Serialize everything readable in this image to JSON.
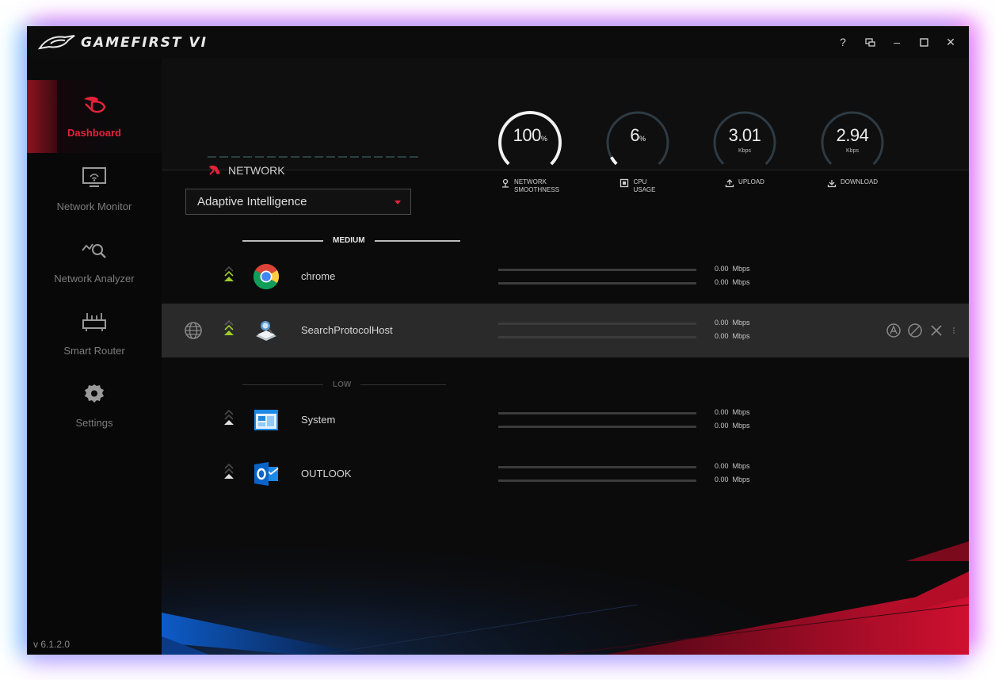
{
  "app": {
    "title": "GAMEFIRST VI",
    "version": "v 6.1.2.0"
  },
  "window_controls": [
    {
      "name": "help-button",
      "glyph": "?"
    },
    {
      "name": "mini-mode-button",
      "glyph": "mini"
    },
    {
      "name": "minimize-button",
      "glyph": "–"
    },
    {
      "name": "maximize-button",
      "glyph": "□"
    },
    {
      "name": "close-button",
      "glyph": "✕"
    }
  ],
  "sidebar": {
    "items": [
      {
        "label": "Dashboard",
        "icon": "dashboard-icon",
        "active": true
      },
      {
        "label": "Network Monitor",
        "icon": "monitor-icon",
        "active": false
      },
      {
        "label": "Network Analyzer",
        "icon": "analyzer-icon",
        "active": false
      },
      {
        "label": "Smart Router",
        "icon": "router-icon",
        "active": false
      },
      {
        "label": "Settings",
        "icon": "gear-icon",
        "active": false
      }
    ]
  },
  "header": {
    "network_label": "NETWORK",
    "gauges": [
      {
        "value": "100",
        "unit": "%",
        "sub": "",
        "label_line1": "NETWORK",
        "label_line2": "SMOOTHNESS",
        "icon": "smoothness-icon",
        "fraction": 1.0
      },
      {
        "value": "6",
        "unit": "%",
        "sub": "",
        "label_line1": "CPU",
        "label_line2": "USAGE",
        "icon": "cpu-icon",
        "fraction": 0.06
      },
      {
        "value": "3.01",
        "unit": "",
        "sub": "Kbps",
        "label_line1": "UPLOAD",
        "label_line2": "",
        "icon": "upload-icon",
        "fraction": 0.0
      },
      {
        "value": "2.94",
        "unit": "",
        "sub": "Kbps",
        "label_line1": "DOWNLOAD",
        "label_line2": "",
        "icon": "download-icon",
        "fraction": 0.0
      }
    ]
  },
  "mode_select": {
    "value": "Adaptive Intelligence"
  },
  "groups": {
    "medium": "MEDIUM",
    "low": "LOW"
  },
  "apps": [
    {
      "name": "chrome",
      "icon": "chrome-icon",
      "up": "0.00",
      "down": "0.00",
      "unit": "Mbps",
      "group": "medium",
      "selected": false,
      "priority": "medium"
    },
    {
      "name": "SearchProtocolHost",
      "icon": "search-protocol-icon",
      "up": "0.00",
      "down": "0.00",
      "unit": "Mbps",
      "group": "medium",
      "selected": true,
      "priority": "medium"
    },
    {
      "name": "System",
      "icon": "system-icon",
      "up": "0.00",
      "down": "0.00",
      "unit": "Mbps",
      "group": "low",
      "selected": false,
      "priority": "low"
    },
    {
      "name": "OUTLOOK",
      "icon": "outlook-icon",
      "up": "0.00",
      "down": "0.00",
      "unit": "Mbps",
      "group": "low",
      "selected": false,
      "priority": "low"
    }
  ],
  "colors": {
    "accent": "#e3223a",
    "priority_green": "#9ccc2a",
    "bg": "#0b0b0c"
  }
}
